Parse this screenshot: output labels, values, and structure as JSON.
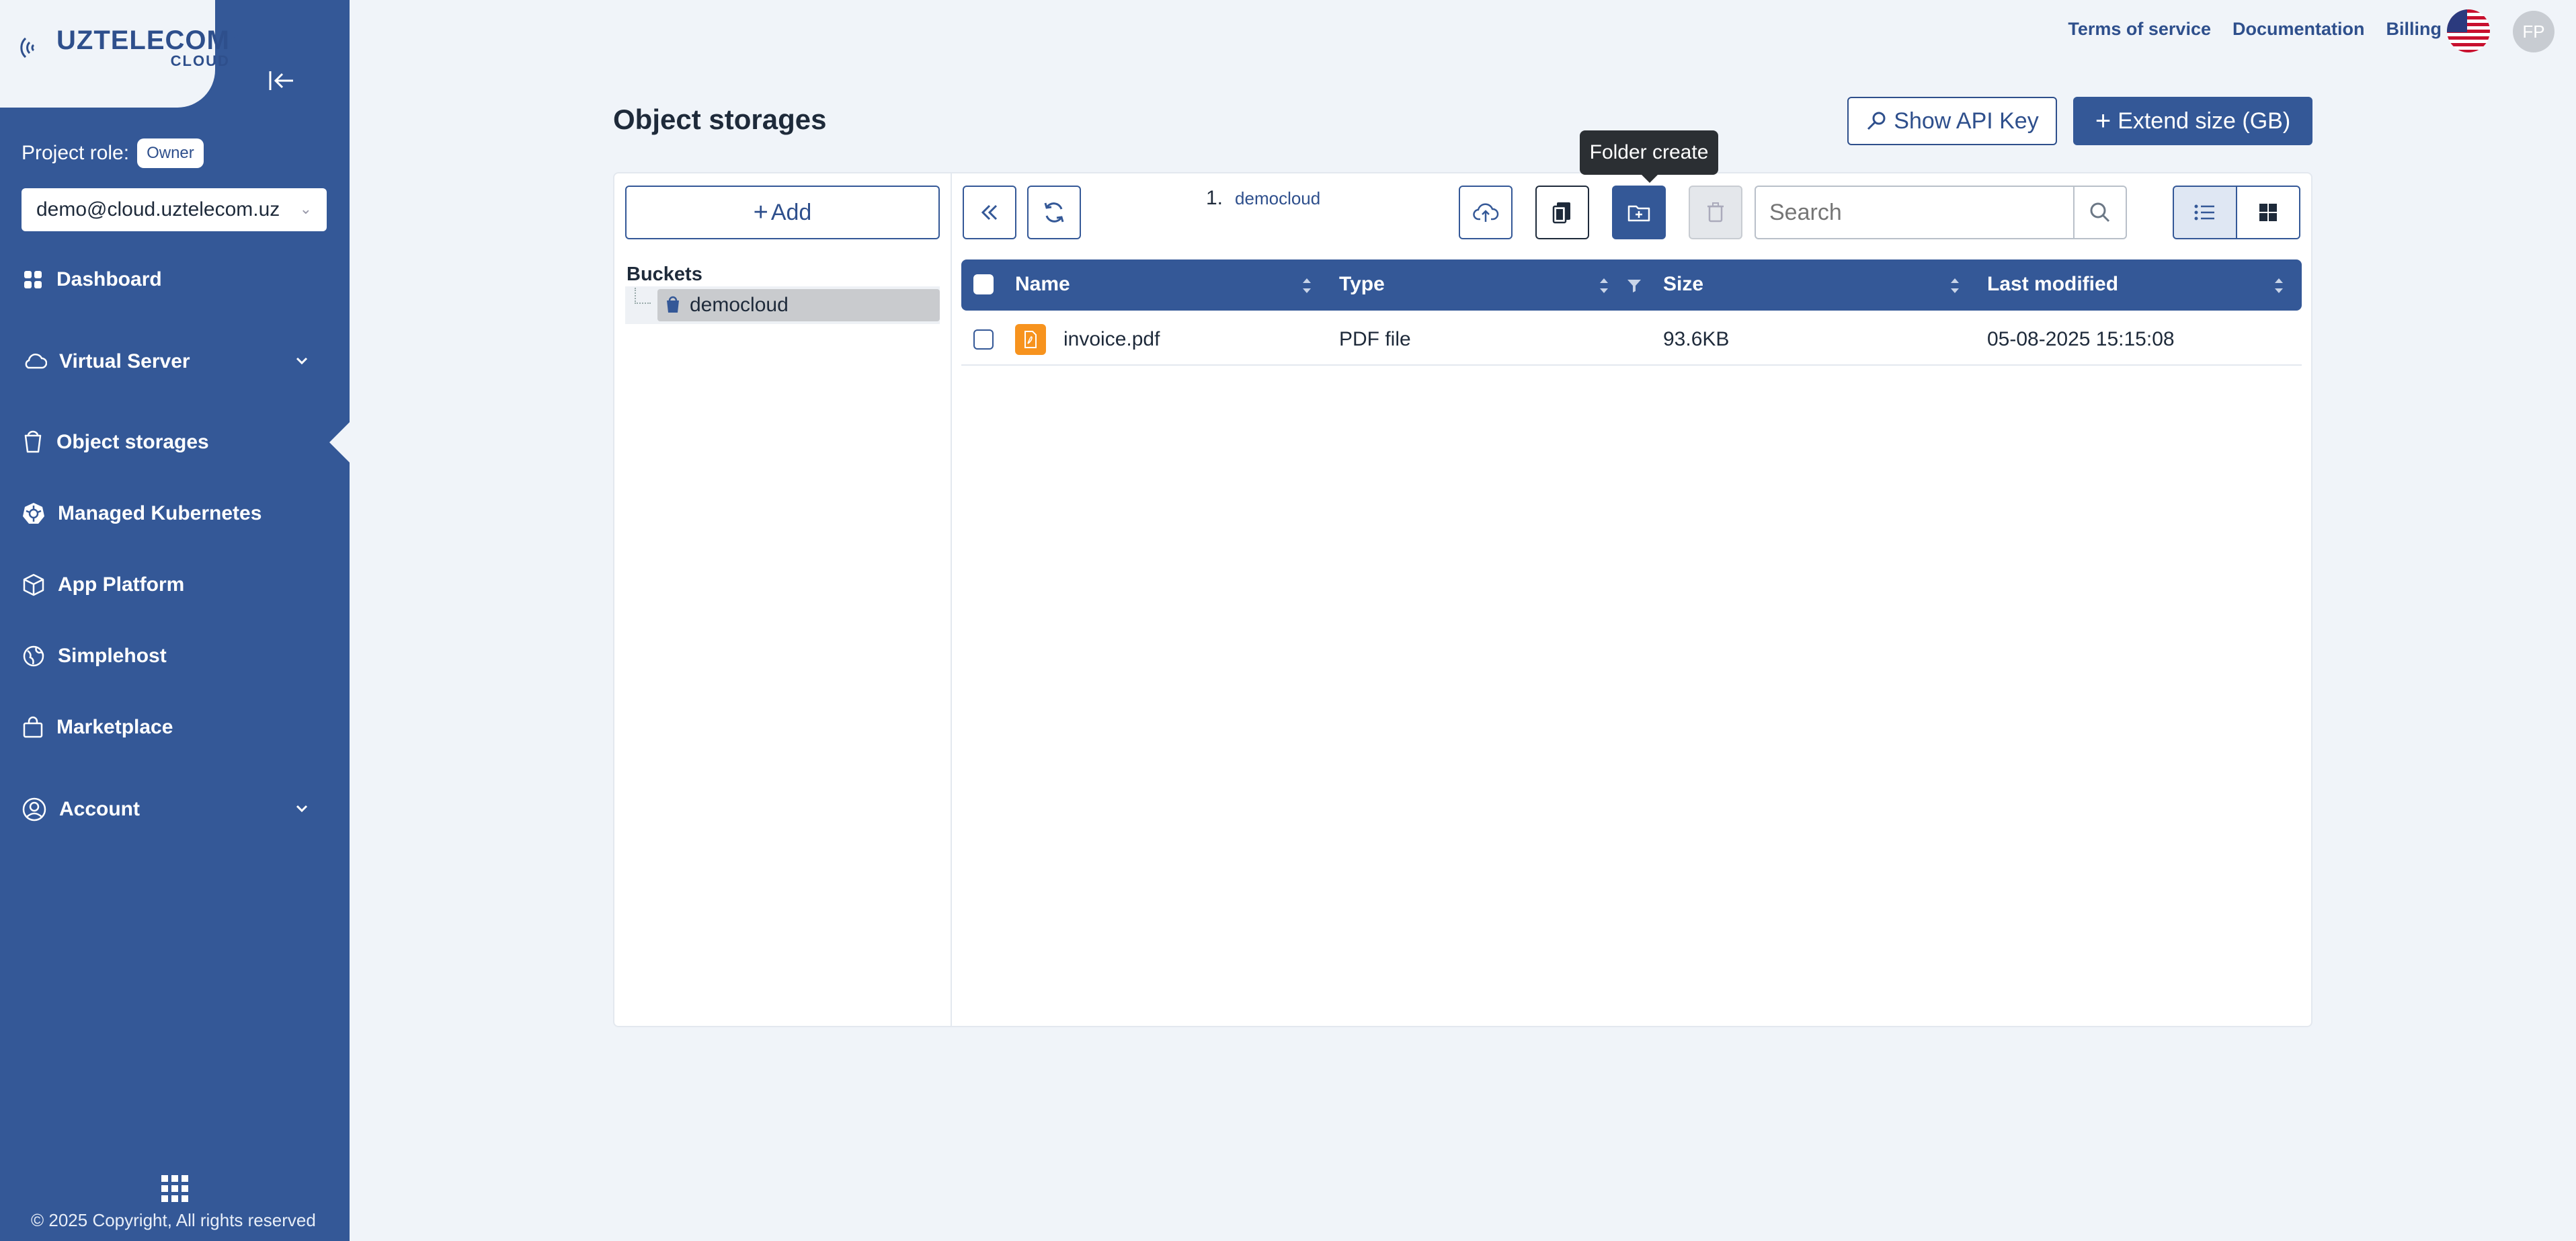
{
  "brand": {
    "line1": "UZTELECOM",
    "line2": "CLOUD"
  },
  "sidebar": {
    "project_role_label": "Project role:",
    "project_role_value": "Owner",
    "account_email": "demo@cloud.uztelecom.uz",
    "items": [
      {
        "label": "Dashboard",
        "icon": "dashboard-icon"
      },
      {
        "label": "Virtual Server",
        "icon": "cloud-icon",
        "expandable": true
      },
      {
        "label": "Object storages",
        "icon": "bucket-icon",
        "active": true
      },
      {
        "label": "Managed Kubernetes",
        "icon": "kubernetes-icon"
      },
      {
        "label": "App Platform",
        "icon": "cube-icon"
      },
      {
        "label": "Simplehost",
        "icon": "globe-icon"
      },
      {
        "label": "Marketplace",
        "icon": "shopping-bag-icon"
      },
      {
        "label": "Account",
        "icon": "user-circle-icon",
        "expandable": true
      }
    ],
    "copyright": "© 2025 Copyright, All rights reserved"
  },
  "topbar": {
    "links": [
      "Terms of service",
      "Documentation",
      "Billing"
    ],
    "avatar_initials": "FP",
    "language_flag": "us-flag-icon"
  },
  "page": {
    "title": "Object storages",
    "show_api_key_label": "Show API Key",
    "extend_size_label": "Extend size (GB)"
  },
  "explorer": {
    "add_label": "Add",
    "buckets_label": "Buckets",
    "buckets": [
      "democloud"
    ],
    "breadcrumb": {
      "index": "1.",
      "path": "democloud"
    },
    "search_placeholder": "Search",
    "tooltip": "Folder create",
    "columns": [
      "Name",
      "Type",
      "Size",
      "Last modified"
    ],
    "files": [
      {
        "name": "invoice.pdf",
        "type": "PDF file",
        "size": "93.6KB",
        "modified": "05-08-2025 15:15:08"
      }
    ]
  },
  "colors": {
    "primary": "#345897",
    "background": "#f0f4f9",
    "pdf": "#f7931e"
  }
}
